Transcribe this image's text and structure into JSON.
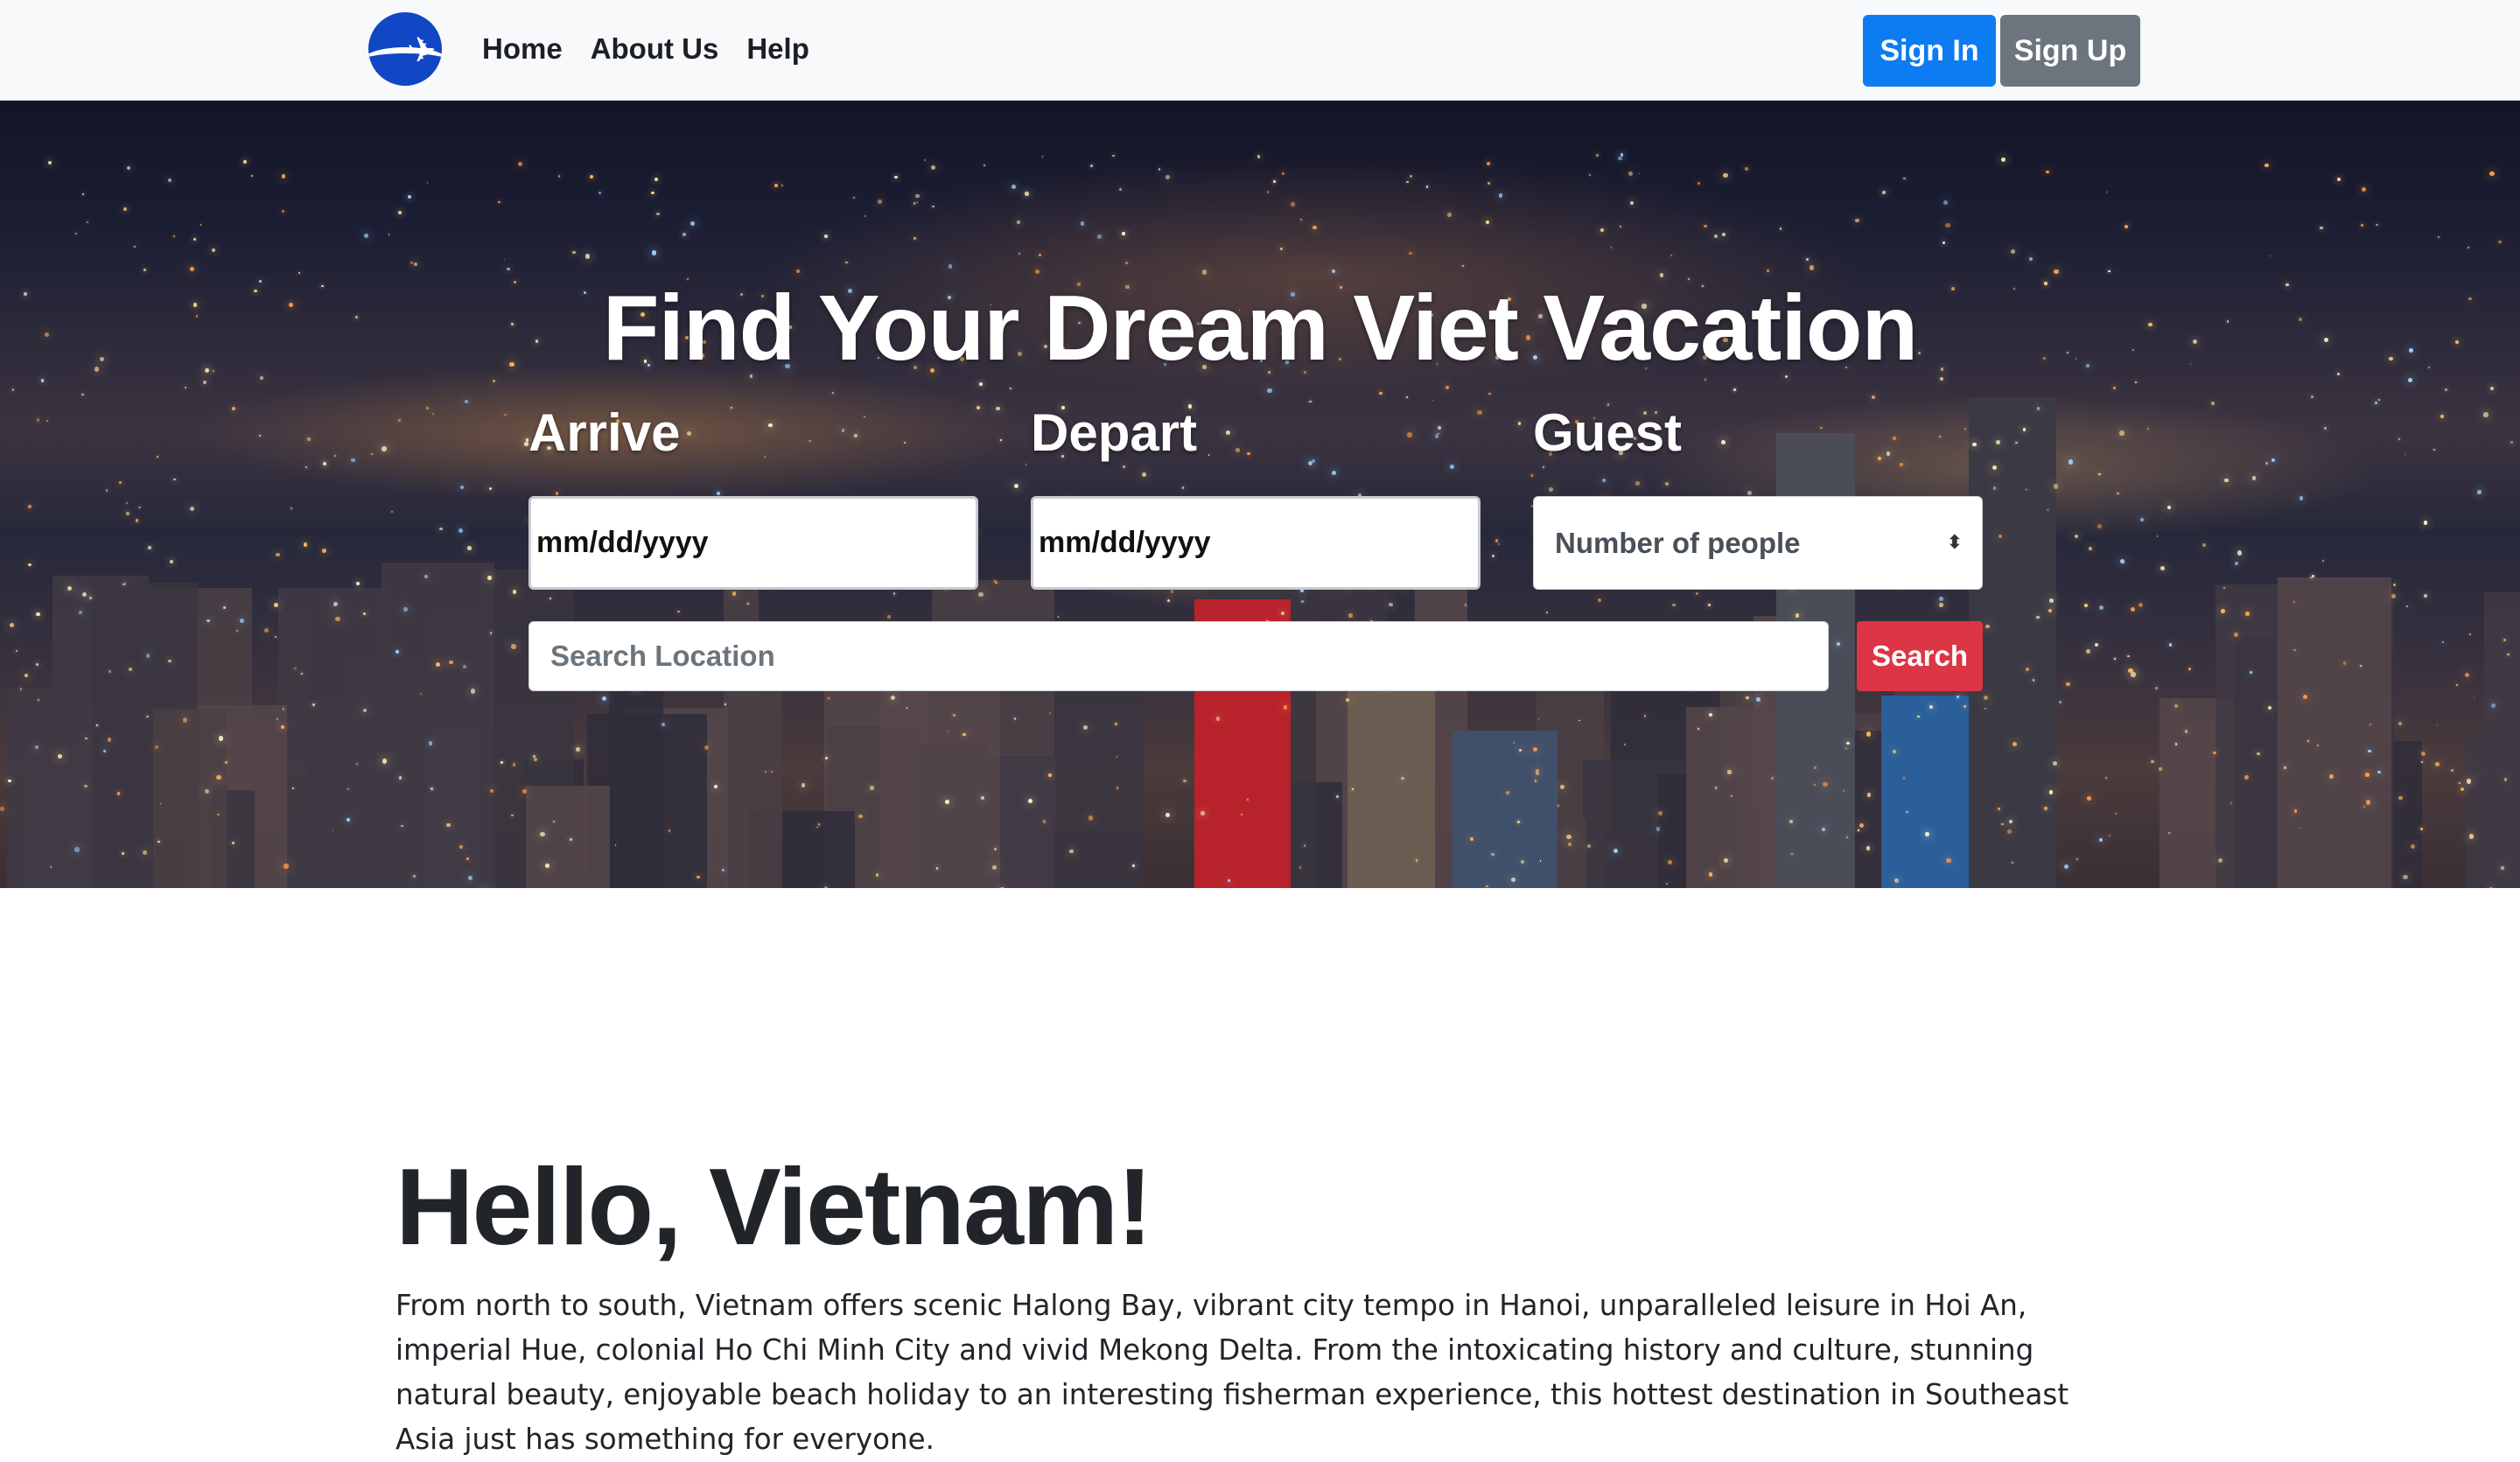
{
  "navbar": {
    "links": [
      "Home",
      "About Us",
      "Help"
    ],
    "sign_in": "Sign In",
    "sign_up": "Sign Up"
  },
  "hero": {
    "title": "Find Your Dream Viet Vacation",
    "arrive_label": "Arrive",
    "depart_label": "Depart",
    "guest_label": "Guest",
    "arrive_value": "mm/dd/yyyy",
    "depart_value": "mm/dd/yyyy",
    "guest_select": "Number of people",
    "search_placeholder": "Search Location",
    "search_button": "Search"
  },
  "content": {
    "heading": "Hello, Vietnam!",
    "paragraph": "From north to south, Vietnam offers scenic Halong Bay, vibrant city tempo in Hanoi, unparalleled leisure in Hoi An, imperial Hue, colonial Ho Chi Minh City and vivid Mekong Delta. From the intoxicating history and culture, stunning natural beauty, enjoyable beach holiday to an interesting fisherman experience, this hottest destination in Southeast Asia just has something for everyone."
  },
  "colors": {
    "primary": "#0d7cf2",
    "secondary": "#6c757d",
    "danger": "#dc3545",
    "logo": "#1146c4"
  },
  "icons": [
    "airplane-logo-icon",
    "select-caret-icon"
  ]
}
